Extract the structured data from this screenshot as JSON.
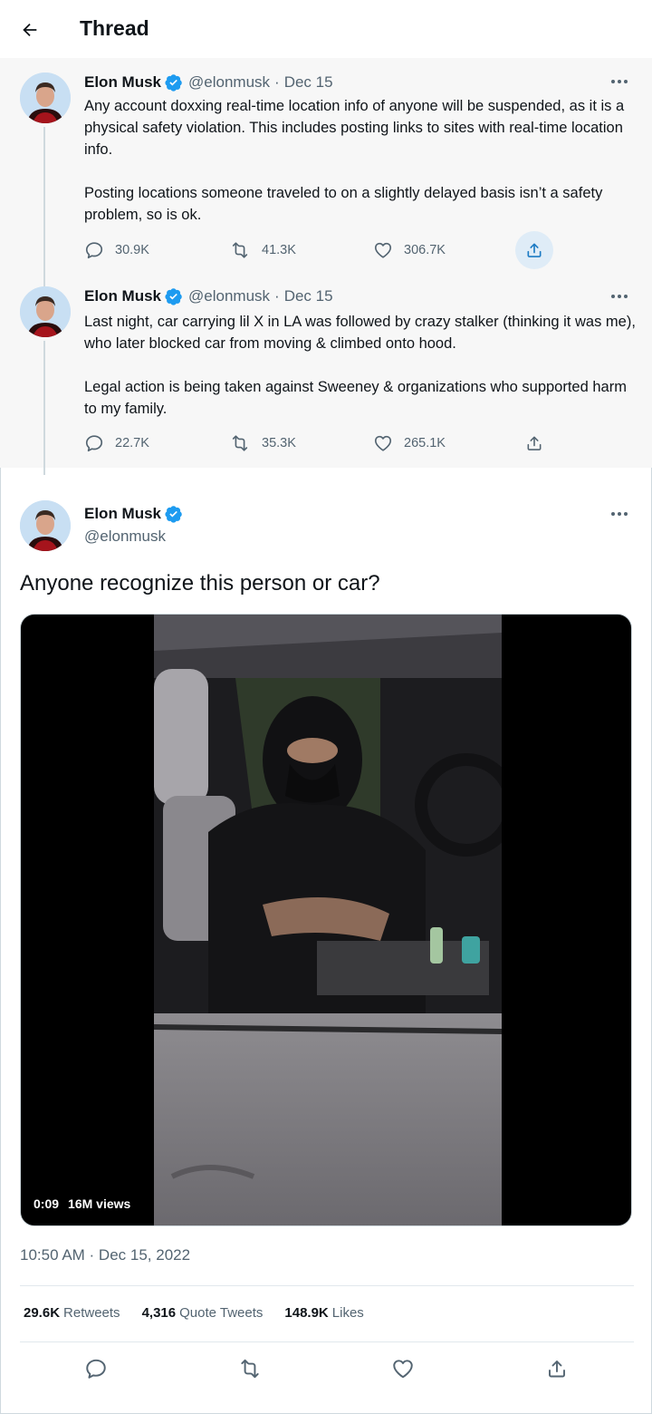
{
  "header": {
    "title": "Thread"
  },
  "tweets": [
    {
      "name": "Elon Musk",
      "handle": "@elonmusk",
      "separator": "·",
      "date": "Dec 15",
      "paragraphs": [
        "Any account doxxing real-time location info of anyone will be suspended, as it is a physical safety violation. This includes posting links to sites with real-time location info.",
        "Posting locations someone traveled to on a slightly delayed basis isn’t a safety problem, so is ok."
      ],
      "replies": "30.9K",
      "retweets": "41.3K",
      "likes": "306.7K"
    },
    {
      "name": "Elon Musk",
      "handle": "@elonmusk",
      "separator": "·",
      "date": "Dec 15",
      "paragraphs": [
        "Last night, car carrying lil X in LA was followed by crazy stalker (thinking it was me), who later blocked car from moving & climbed onto hood.",
        "Legal action is being taken against Sweeney & organizations who supported harm to my family."
      ],
      "replies": "22.7K",
      "retweets": "35.3K",
      "likes": "265.1K"
    }
  ],
  "main": {
    "name": "Elon Musk",
    "handle": "@elonmusk",
    "text": "Anyone recognize this person or car?",
    "video_time": "0:09",
    "video_views": "16M views",
    "timestamp": "10:50 AM · Dec 15, 2022",
    "stats": [
      {
        "value": "29.6K",
        "label": "Retweets"
      },
      {
        "value": "4,316",
        "label": "Quote Tweets"
      },
      {
        "value": "148.9K",
        "label": "Likes"
      }
    ]
  },
  "icons": {
    "back": "arrow-left-icon",
    "verified": "verified-badge-icon",
    "more": "more-icon",
    "reply": "reply-icon",
    "retweet": "retweet-icon",
    "like": "heart-icon",
    "share": "share-icon"
  },
  "colors": {
    "verified": "#1d9bf0",
    "muted": "#536471",
    "thread_bg": "#f7f7f7",
    "share_highlight": "#dfecf7"
  }
}
